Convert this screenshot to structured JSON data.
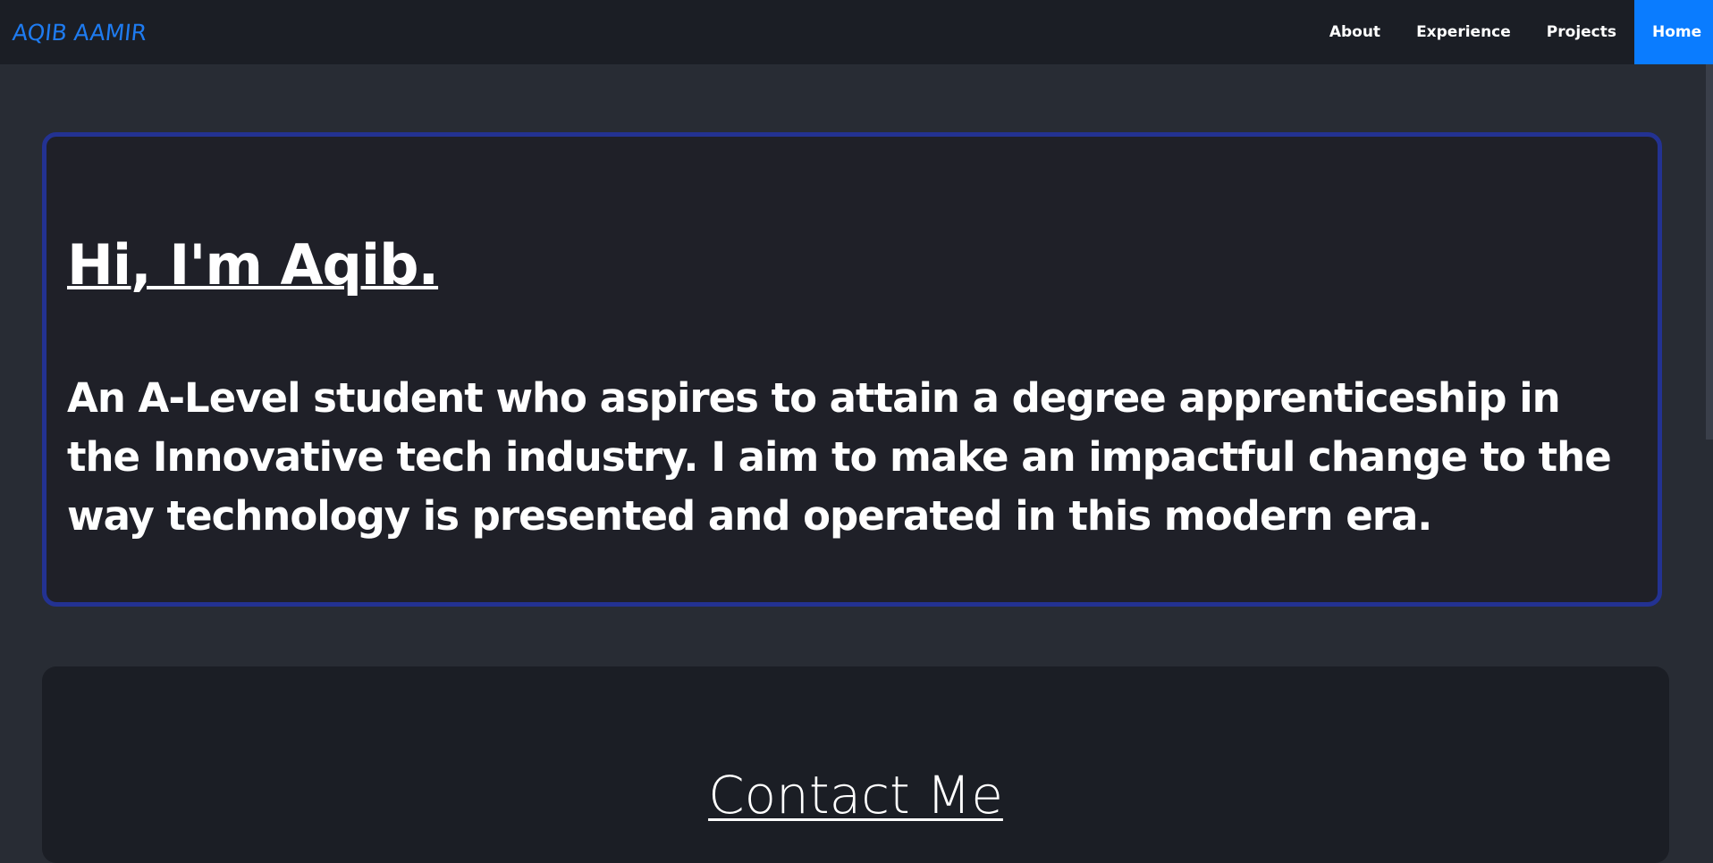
{
  "navbar": {
    "brand": "AQIB AAMIR",
    "links": [
      {
        "label": "About"
      },
      {
        "label": "Experience"
      },
      {
        "label": "Projects"
      },
      {
        "label": "Home",
        "active": true
      }
    ]
  },
  "hero": {
    "title": "Hi, I'm Aqib.",
    "text": "An A-Level student who aspires to attain a degree apprenticeship in the Innovative tech industry. I aim to make an impactful change to the way technology is presented and operated in this modern era."
  },
  "contact": {
    "title": "Contact Me"
  },
  "colors": {
    "page_background": "#282c34",
    "navbar_background": "#1b1e25",
    "brand": "#1e7bf0",
    "active_nav": "#0a7cff",
    "card_border": "#233292",
    "card_background": "#1f2028"
  }
}
